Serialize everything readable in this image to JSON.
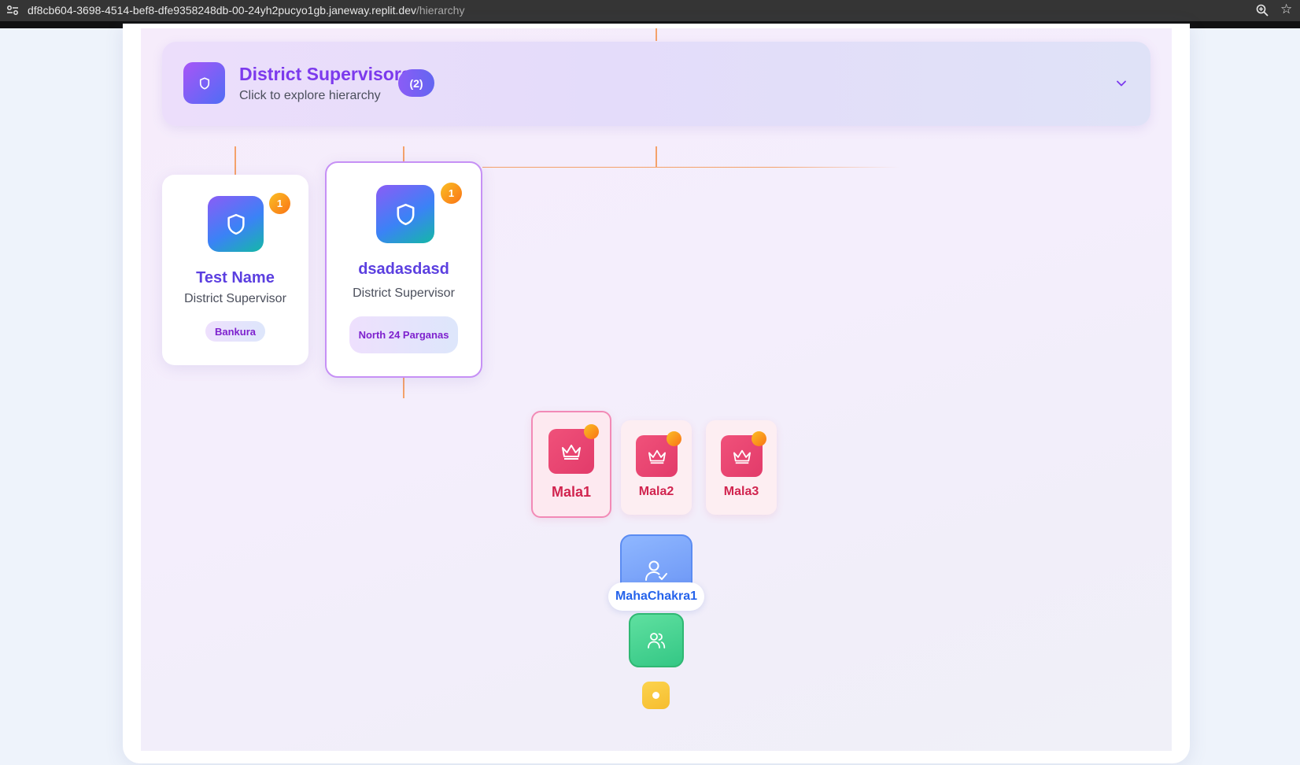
{
  "browser": {
    "url_host": "df8cb604-3698-4514-bef8-dfe9358248db-00-24yh2pucyo1gb.janeway.replit.dev",
    "url_path": "/hierarchy"
  },
  "section": {
    "title": "District Supervisors",
    "count": "(2)",
    "subtitle": "Click to explore hierarchy",
    "icon": "shield-icon",
    "toggle_icon": "chevron-down-icon"
  },
  "supervisors": [
    {
      "name": "Test Name",
      "role": "District Supervisor",
      "location": "Bankura",
      "badge": "1",
      "icon": "shield-icon"
    },
    {
      "name": "dsadasdasd",
      "role": "District Supervisor",
      "location": "North 24 Parganas",
      "badge": "1",
      "icon": "shield-icon",
      "selected": true
    }
  ],
  "malas": [
    {
      "name": "Mala1",
      "icon": "crown-icon",
      "selected": true
    },
    {
      "name": "Mala2",
      "icon": "crown-icon"
    },
    {
      "name": "Mala3",
      "icon": "crown-icon"
    }
  ],
  "mahachakra": {
    "name": "MahaChakra1",
    "icon": "user-check-icon"
  },
  "group_node": {
    "icon": "users-icon"
  },
  "leaf_node": {
    "icon": "dot-icon"
  },
  "colors": {
    "accent_purple": "#7c3aed",
    "connector": "#f4a26b",
    "mala_pink": "#e23b6a",
    "badge_orange": "#f97316",
    "mahachakra_blue": "#6b95f5",
    "group_green": "#34c785",
    "leaf_yellow": "#f6bd2f"
  }
}
